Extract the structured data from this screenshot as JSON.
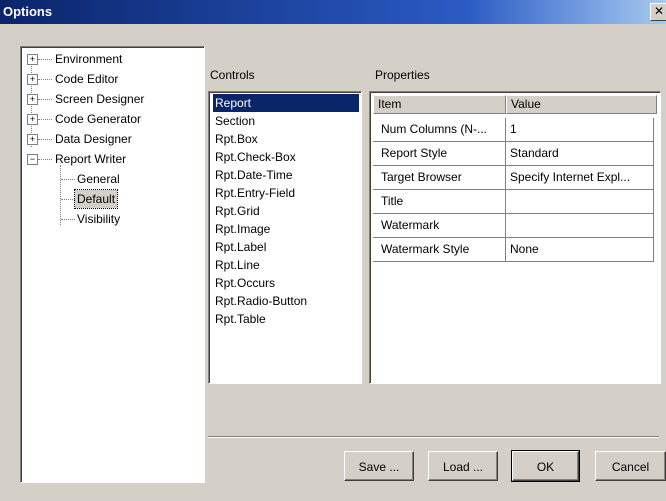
{
  "window": {
    "title": "Options",
    "close_glyph": "✕"
  },
  "tree": {
    "items": [
      {
        "label": "Environment",
        "toggle": "+"
      },
      {
        "label": "Code Editor",
        "toggle": "+"
      },
      {
        "label": "Screen Designer",
        "toggle": "+"
      },
      {
        "label": "Code Generator",
        "toggle": "+"
      },
      {
        "label": "Data Designer",
        "toggle": "+"
      },
      {
        "label": "Report Writer",
        "toggle": "−"
      }
    ],
    "children": [
      {
        "label": "General"
      },
      {
        "label": "Default"
      },
      {
        "label": "Visibility"
      }
    ]
  },
  "controls": {
    "label": "Controls",
    "items": [
      "Report",
      "Section",
      "Rpt.Box",
      "Rpt.Check-Box",
      "Rpt.Date-Time",
      "Rpt.Entry-Field",
      "Rpt.Grid",
      "Rpt.Image",
      "Rpt.Label",
      "Rpt.Line",
      "Rpt.Occurs",
      "Rpt.Radio-Button",
      "Rpt.Table"
    ],
    "selected": "Report"
  },
  "properties": {
    "label": "Properties",
    "headers": {
      "item": "Item",
      "value": "Value"
    },
    "rows": [
      {
        "item": "Num Columns (N-...",
        "value": "1"
      },
      {
        "item": "Report Style",
        "value": "Standard"
      },
      {
        "item": "Target Browser",
        "value": "Specify Internet Expl..."
      },
      {
        "item": "Title",
        "value": ""
      },
      {
        "item": "Watermark",
        "value": ""
      },
      {
        "item": "Watermark Style",
        "value": "None"
      }
    ]
  },
  "buttons": {
    "save": "Save ...",
    "load": "Load ...",
    "ok": "OK",
    "cancel": "Cancel"
  }
}
